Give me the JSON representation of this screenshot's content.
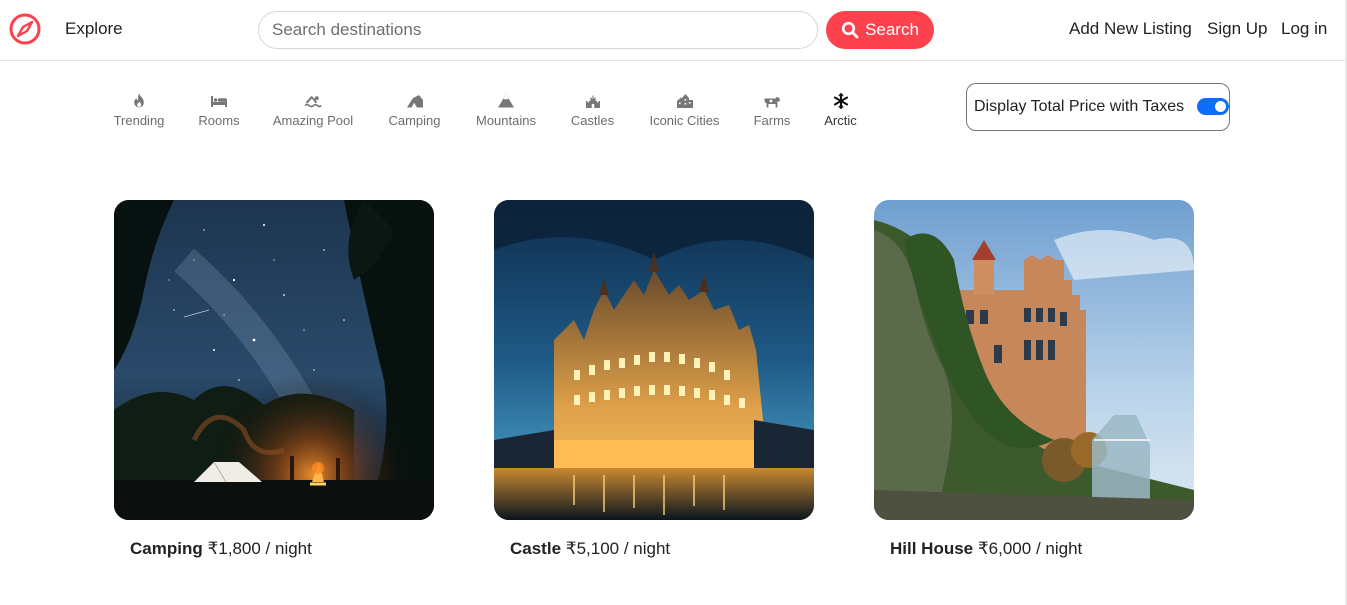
{
  "colors": {
    "brand": "#fe424d",
    "toggle_on": "#0d6efd"
  },
  "navbar": {
    "logo_icon": "compass-icon",
    "explore": "Explore",
    "search_placeholder": "Search destinations",
    "search_button": "Search",
    "add_listing": "Add New Listing",
    "sign_up": "Sign Up",
    "log_in": "Log in"
  },
  "filters": [
    {
      "label": "Trending",
      "icon": "fire-icon"
    },
    {
      "label": "Rooms",
      "icon": "bed-icon"
    },
    {
      "label": "Amazing Pool",
      "icon": "swimmer-icon"
    },
    {
      "label": "Camping",
      "icon": "campground-icon"
    },
    {
      "label": "Mountains",
      "icon": "mountain-icon"
    },
    {
      "label": "Castles",
      "icon": "castle-icon"
    },
    {
      "label": "Iconic Cities",
      "icon": "city-icon"
    },
    {
      "label": "Farms",
      "icon": "cow-icon"
    },
    {
      "label": "Arctic",
      "icon": "snowflake-icon"
    }
  ],
  "tax_toggle": {
    "label": "Display Total Price with Taxes",
    "enabled": true
  },
  "listings": [
    {
      "title": "Camping",
      "price": "₹1,800",
      "per": " / night",
      "image": "night-campsite-photo"
    },
    {
      "title": "Castle",
      "price": "₹5,100",
      "per": " / night",
      "image": "illuminated-castle-hotel-photo"
    },
    {
      "title": "Hill House",
      "price": "₹6,000",
      "per": " / night",
      "image": "hillside-manor-photo"
    }
  ]
}
